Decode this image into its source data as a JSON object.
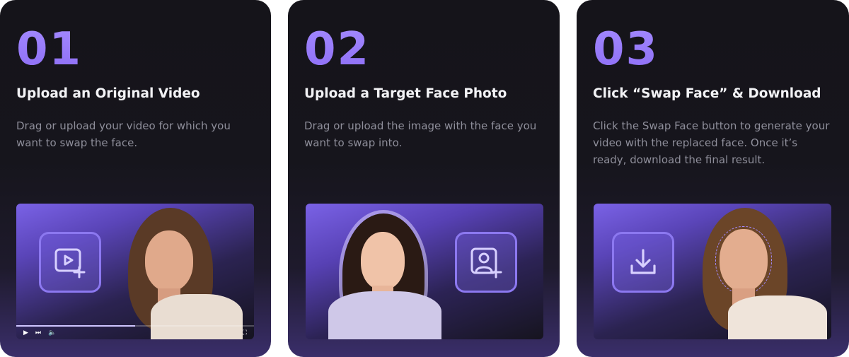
{
  "steps": [
    {
      "number": "01",
      "title": "Upload an Original Video",
      "description": "Drag or upload your video for which you want to swap the face.",
      "icon": "video-add-icon",
      "player": {
        "progress": 0.5
      }
    },
    {
      "number": "02",
      "title": "Upload a Target Face Photo",
      "description": "Drag or upload the image with the face you want to swap into.",
      "icon": "photo-person-add-icon"
    },
    {
      "number": "03",
      "title": "Click “Swap Face” & Download",
      "description": "Click the Swap Face button to generate your video with the replaced face. Once it’s ready, download the final result.",
      "icon": "download-icon"
    }
  ],
  "colors": {
    "accent": "#8c6cf5",
    "card_bg": "#15141a",
    "text_primary": "#f2f2f5",
    "text_secondary": "#8e8e9a"
  }
}
